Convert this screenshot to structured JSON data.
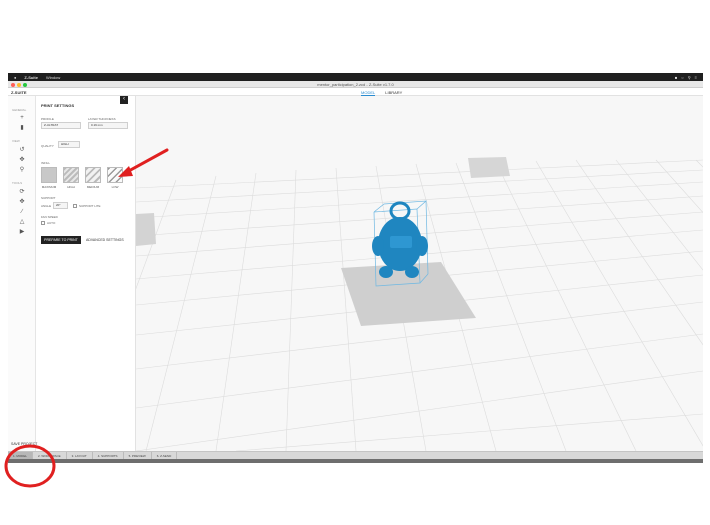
{
  "menubar": {
    "apple": "",
    "app": "Z-Suite",
    "menu": "Window"
  },
  "titlebar": {
    "title": "mentor_participation_2.zcd - Z-Suite v1.7.0"
  },
  "header": {
    "logo": "Z-SUITE",
    "tabs": [
      "MODEL",
      "LIBRARY"
    ]
  },
  "rail": {
    "groups": [
      "GENERAL",
      "VIEW",
      "TOOLS"
    ]
  },
  "panel": {
    "title": "PRINT SETTINGS",
    "profile_label": "PROFILE",
    "profile_value": "Z-ULTRAT",
    "layer_label": "LAYER THICKNESS",
    "layer_value": "0.19 mm",
    "quality_label": "QUALITY",
    "quality_value": "HIGH",
    "infill_label": "INFILL",
    "infill_options": [
      "MAXIMUM",
      "HIGH",
      "MEDIUM",
      "LOW"
    ],
    "support_label": "SUPPORT",
    "angle_label": "ANGLE",
    "angle_value": "20°",
    "support_lite_label": "SUPPORT LITE",
    "fan_label": "FAN SPEED",
    "fan_auto": "AUTO",
    "prepare_button": "PREPARE TO PRINT",
    "advanced_button": "ADVANCED SETTINGS"
  },
  "save_project": "SAVE PROJECT",
  "bottombar": {
    "items": [
      "1. MODEL",
      "2. WORKSPACE",
      "3. LAYOUT",
      "4. SUPPORTS",
      "5. PREVIEW",
      "6. Z-SEND"
    ]
  },
  "colors": {
    "model": "#1f86c0",
    "annotation": "#e02020",
    "accent": "#2a8cd0"
  }
}
